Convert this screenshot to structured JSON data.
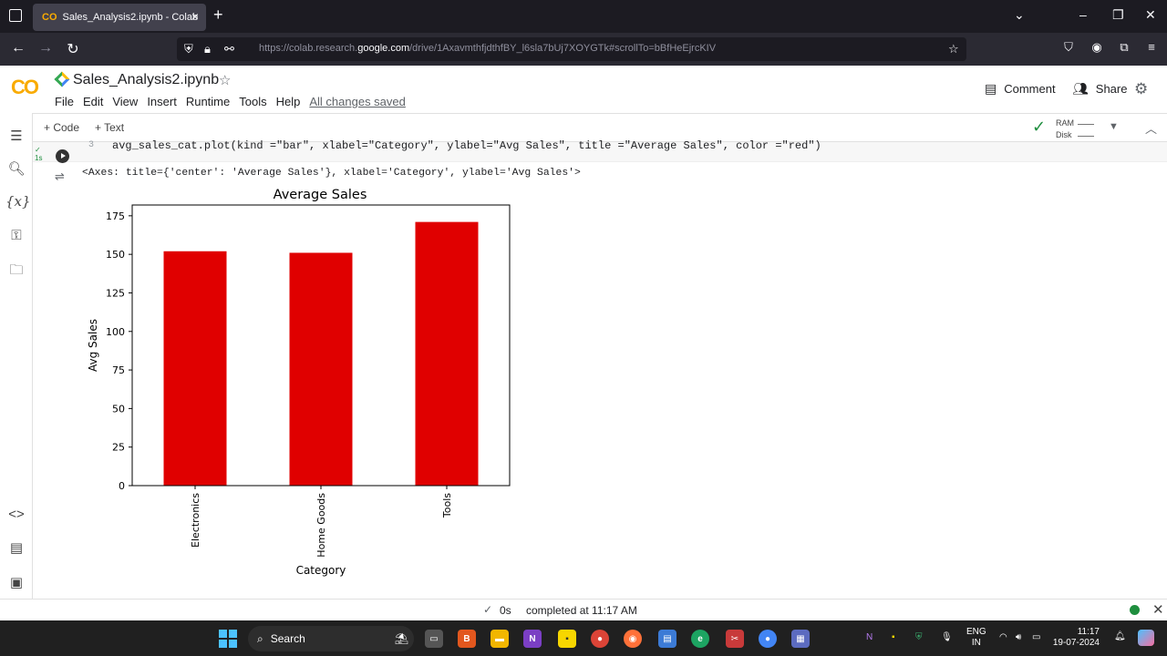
{
  "browser": {
    "tab_title": "Sales_Analysis2.ipynb - Colab",
    "tab_icon": "CO",
    "url_prefix": "https://colab.research.",
    "url_domain": "google.com",
    "url_path": "/drive/1AxavmthfjdthfBY_l6sla7bUj7XOYGTk#scrollTo=bBfHeEjrcKIV"
  },
  "colab": {
    "logo": "CO",
    "notebook_title": "Sales_Analysis2.ipynb",
    "menu": [
      "File",
      "Edit",
      "View",
      "Insert",
      "Runtime",
      "Tools",
      "Help"
    ],
    "saved_status": "All changes saved",
    "comment_label": "Comment",
    "share_label": "Share",
    "add_code_label": "+ Code",
    "add_text_label": "+ Text",
    "ram_label": "RAM",
    "disk_label": "Disk"
  },
  "cell": {
    "exec_time": "1s",
    "line_number": "3",
    "code": "avg_sales_cat.plot(kind =\"bar\", xlabel=\"Category\", ylabel=\"Avg Sales\", title =\"Average Sales\", color =\"red\")",
    "output_text": "<Axes: title={'center': 'Average Sales'}, xlabel='Category', ylabel='Avg Sales'>"
  },
  "chart_data": {
    "type": "bar",
    "title": "Average Sales",
    "xlabel": "Category",
    "ylabel": "Avg Sales",
    "categories": [
      "Electronics",
      "Home Goods",
      "Tools"
    ],
    "values": [
      152,
      151,
      171
    ],
    "ylim": [
      0,
      182
    ],
    "yticks": [
      0,
      25,
      50,
      75,
      100,
      125,
      150,
      175
    ],
    "color": "#e00000",
    "grid": false,
    "legend": "none"
  },
  "status": {
    "duration": "0s",
    "message": "completed at 11:17 AM"
  },
  "taskbar": {
    "search_label": "Search",
    "lang_top": "ENG",
    "lang_bottom": "IN",
    "time": "11:17",
    "date": "19-07-2024"
  }
}
